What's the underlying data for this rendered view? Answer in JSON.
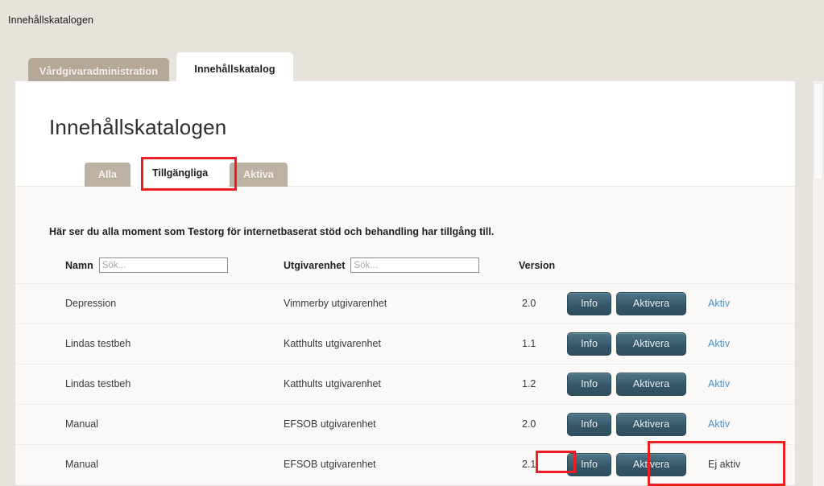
{
  "document": {
    "title": "Innehållskatalogen"
  },
  "top_tabs": [
    {
      "label": "Vårdgivaradministration",
      "active": false
    },
    {
      "label": "Innehållskatalog",
      "active": true
    }
  ],
  "page": {
    "heading": "Innehållskatalogen",
    "intro": "Här ser du alla moment som Testorg för internetbaserat stöd och behandling har tillgång till."
  },
  "sub_tabs": [
    {
      "label": "Alla",
      "selected": false
    },
    {
      "label": "Tillgängliga",
      "selected": true
    },
    {
      "label": "Aktiva",
      "selected": false
    }
  ],
  "table": {
    "headers": {
      "namn": "Namn",
      "utgivarenhet": "Utgivarenhet",
      "version": "Version"
    },
    "search": {
      "namn_placeholder": "Sök...",
      "namn_value": "",
      "utgivarenhet_placeholder": "Sök...",
      "utgivarenhet_value": ""
    },
    "buttons": {
      "info": "Info",
      "aktivera": "Aktivera"
    },
    "rows": [
      {
        "namn": "Depression",
        "utgivarenhet": "Vimmerby utgivarenhet",
        "version": "2.0",
        "info": "Info",
        "aktivera": "Aktivera",
        "status": "Aktiv",
        "status_is_link": true
      },
      {
        "namn": "Lindas testbeh",
        "utgivarenhet": "Katthults utgivarenhet",
        "version": "1.1",
        "info": "Info",
        "aktivera": "Aktivera",
        "status": "Aktiv",
        "status_is_link": true
      },
      {
        "namn": "Lindas testbeh",
        "utgivarenhet": "Katthults utgivarenhet",
        "version": "1.2",
        "info": "Info",
        "aktivera": "Aktivera",
        "status": "Aktiv",
        "status_is_link": true
      },
      {
        "namn": "Manual",
        "utgivarenhet": "EFSOB utgivarenhet",
        "version": "2.0",
        "info": "Info",
        "aktivera": "Aktivera",
        "status": "Aktiv",
        "status_is_link": true
      },
      {
        "namn": "Manual",
        "utgivarenhet": "EFSOB utgivarenhet",
        "version": "2.1",
        "info": "Info",
        "aktivera": "Aktivera",
        "status": "Ej aktiv",
        "status_is_link": false
      }
    ]
  },
  "annotations": {
    "highlight_color": "#ee1c23",
    "boxes": [
      {
        "name": "subtab-tillgangliga"
      },
      {
        "name": "version-2-1"
      },
      {
        "name": "aktivera-ej-aktiv"
      }
    ]
  },
  "colors": {
    "page_background": "#e8e2dc",
    "tab_inactive": "#b5a899",
    "panel": "#ffffff",
    "body_background": "#faf9f7",
    "button": "#3b6071",
    "link": "#5190c0"
  }
}
